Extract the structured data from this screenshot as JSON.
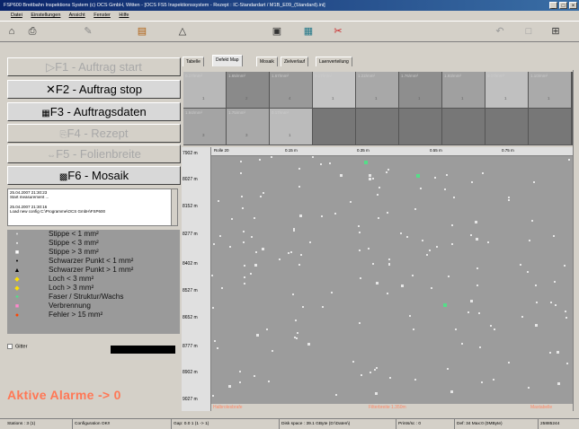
{
  "window": {
    "title": "FSP600 Breitbahn Inspektions System (c) OCS GmbH, Witten - [OCS FS5 Inspektionssystem - Rezept : IC-Standardart / M1B_E09_(Standard).ini]"
  },
  "menu": [
    "Datei",
    "Einstellungen",
    "Ansicht",
    "Fenster",
    "Hilfe"
  ],
  "function_buttons": [
    {
      "label": "F1 - Auftrag start",
      "icon": "play-icon",
      "enabled": false
    },
    {
      "label": "F2 - Auftrag stop",
      "icon": "stop-x-icon",
      "enabled": true
    },
    {
      "label": "F3 - Auftragsdaten",
      "icon": "data-icon",
      "enabled": true
    },
    {
      "label": "F4 - Rezept",
      "icon": "recipe-icon",
      "enabled": false
    },
    {
      "label": "F5 - Folienbreite",
      "icon": "width-icon",
      "enabled": false
    },
    {
      "label": "F6 - Mosaik",
      "icon": "mosaic-icon",
      "enabled": true
    }
  ],
  "log": [
    "25.04.2007 21:30:23",
    "Start measurement ...",
    "",
    "25.04.2007 21:30:16",
    "Load new config C:\\Programme\\OCS GmbH\\FSP600"
  ],
  "legend": [
    {
      "label": "Stippe < 1 mm²",
      "symbol": "•",
      "color": "#dddddd"
    },
    {
      "label": "Stippe < 3 mm²",
      "symbol": "▪",
      "color": "#eeeeee"
    },
    {
      "label": "Stippe > 3 mm²",
      "symbol": "■",
      "color": "#ffffff"
    },
    {
      "label": "Schwarzer Punkt < 1 mm²",
      "symbol": "•",
      "color": "#000000"
    },
    {
      "label": "Schwarzer Punkt > 1 mm²",
      "symbol": "▲",
      "color": "#000000"
    },
    {
      "label": "Loch < 3 mm²",
      "symbol": "◆",
      "color": "#ffe000"
    },
    {
      "label": "Loch > 3 mm²",
      "symbol": "◆",
      "color": "#ffe000"
    },
    {
      "label": "Faser / Struktur/Wachs",
      "symbol": "✦",
      "color": "#55dd88"
    },
    {
      "label": "Verbrennung",
      "symbol": "■",
      "color": "#ff88cc"
    },
    {
      "label": "Fehler > 15 mm²",
      "symbol": "●",
      "color": "#ff4400"
    }
  ],
  "gitter_label": "Gitter",
  "alarm_text": "Aktive Alarme -> 0",
  "tabs": [
    "Tabelle",
    "Defekt Map",
    "Mosaik",
    "Zielverlauf",
    "Laenverteilung"
  ],
  "active_tab": 1,
  "mosaic_rows": [
    [
      {
        "label": "0.17/mm²",
        "n": "1"
      },
      {
        "label": "1.65/mm²",
        "n": "2"
      },
      {
        "label": "1.67/mm²",
        "n": "4"
      },
      {
        "label": "0.17/mm²",
        "n": "1"
      },
      {
        "label": "1.22/mm²",
        "n": "1"
      },
      {
        "label": "1.76/mm²",
        "n": "1"
      },
      {
        "label": "1.93/mm²",
        "n": "1"
      },
      {
        "label": "0.17/mm²",
        "n": "1"
      },
      {
        "label": "1.10/mm²",
        "n": "1"
      }
    ],
    [
      {
        "label": "1.94/mm²",
        "n": "3"
      },
      {
        "label": "1.75/mm²",
        "n": "3"
      },
      {
        "label": "0.17/mm²",
        "n": "1"
      },
      {
        "label": "",
        "n": ""
      },
      {
        "label": "",
        "n": ""
      },
      {
        "label": "",
        "n": ""
      },
      {
        "label": "",
        "n": ""
      },
      {
        "label": "",
        "n": ""
      },
      {
        "label": "",
        "n": ""
      }
    ]
  ],
  "y_axis_labels": [
    "7902 m",
    "8027 m",
    "8152 m",
    "8277 m",
    "8402 m",
    "8527 m",
    "8652 m",
    "8777 m",
    "8902 m",
    "9027 m"
  ],
  "x_axis_labels": [
    "Rolle 20",
    "0.15 m",
    "0.35 m",
    "0.55 m",
    "0.75 m"
  ],
  "bottom_labels": {
    "left": "Halbrolesbrafe",
    "center": "Filterbreite 1.350m",
    "right": "Maxtabelle"
  },
  "status_bar": [
    "Stations : 3 (1)",
    "Configuration OK!!",
    "Gap: 0.0 1 (1 -> 1)",
    "Disk space : 39.1 GByte (D:\\Daten\\)",
    "Prints/sc : 0",
    "Def: 34  Max:0  (0MByte)",
    "25885244"
  ]
}
